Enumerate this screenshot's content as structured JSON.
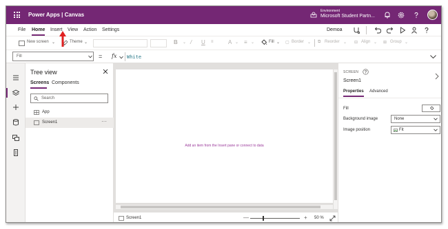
{
  "titlebar": {
    "app_title": "Power Apps  |  Canvas",
    "environment_label": "Environment",
    "environment_name": "Microsoft Student Partn...",
    "bg_color": "#742774"
  },
  "menubar": {
    "items": [
      {
        "label": "File"
      },
      {
        "label": "Home"
      },
      {
        "label": "Insert"
      },
      {
        "label": "View"
      },
      {
        "label": "Action"
      },
      {
        "label": "Settings"
      }
    ],
    "active": "Home",
    "app_name": "Demoa"
  },
  "toolbar": {
    "new_screen": "New screen",
    "theme": "Theme",
    "fill": "Fill",
    "border": "Border",
    "reorder": "Reorder",
    "align": "Align",
    "group": "Group",
    "bold": "B",
    "italic": "/",
    "underline": "U",
    "font_color": "A",
    "align_text": "≡"
  },
  "formulabar": {
    "property": "Fill",
    "equals": "=",
    "fx": "fx",
    "formula": "White"
  },
  "tree_view": {
    "title": "Tree view",
    "tabs": [
      {
        "label": "Screens"
      },
      {
        "label": "Components"
      }
    ],
    "active_tab": "Screens",
    "search_placeholder": "Search",
    "rows": [
      {
        "label": "App",
        "selected": false
      },
      {
        "label": "Screen1",
        "selected": true
      }
    ],
    "more": "···"
  },
  "canvas": {
    "hint": "Add an item from the Insert pane or connect to data"
  },
  "statusbar": {
    "screen_label": "Screen1",
    "minus": "—",
    "plus": "+",
    "zoom": "50  %",
    "zoom_value": 50
  },
  "properties": {
    "kind": "SCREEN",
    "name": "Screen1",
    "tabs": [
      {
        "label": "Properties"
      },
      {
        "label": "Advanced"
      }
    ],
    "active_tab": "Properties",
    "fill_label": "Fill",
    "background_image_label": "Background image",
    "background_image_value": "None",
    "image_position_label": "Image position",
    "image_position_value": "Fit"
  },
  "colors": {
    "accent": "#742774",
    "canvas_hint": "#9b3a9b",
    "formula": "#2b7a8a",
    "annotation_arrow": "#e02020"
  }
}
